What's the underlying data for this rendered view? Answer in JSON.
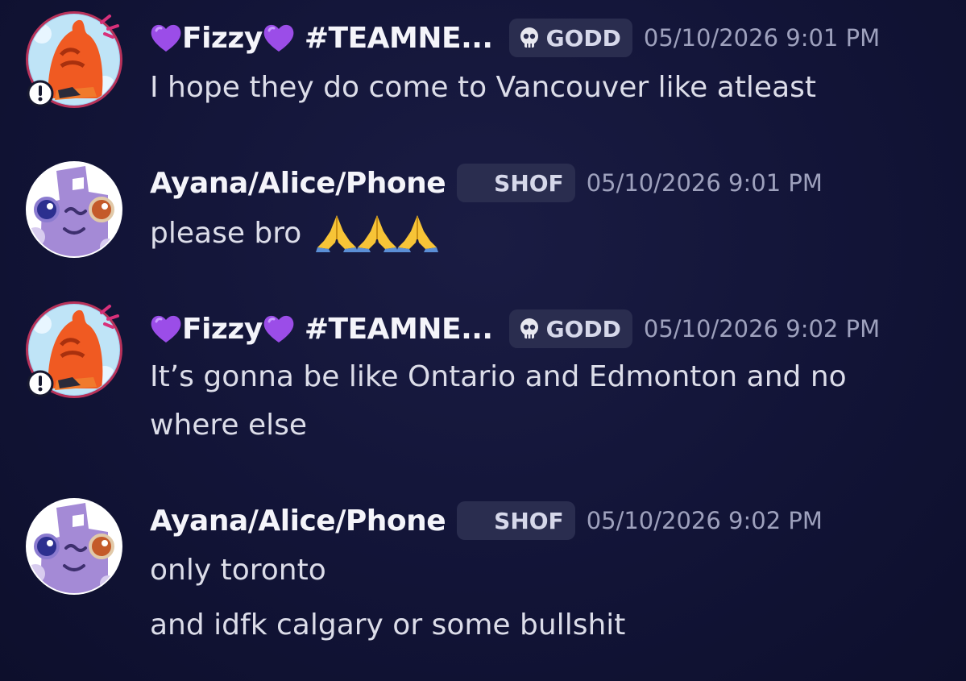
{
  "messages": [
    {
      "username": "Fizzy",
      "username_suffix": " #TEAMNE...",
      "tag": "GODD",
      "tag_icon": "skull-icon",
      "timestamp": "05/10/2026 9:01 PM",
      "lines": [
        "I hope they do come to Vancouver like atleast"
      ]
    },
    {
      "username": "Ayana/Alice/Phone",
      "tag": "SHOF",
      "tag_icon": "crescent-icon",
      "timestamp": "05/10/2026 9:01 PM",
      "lines": [
        "please bro"
      ],
      "emoji": [
        "folded-hands-emoji",
        "folded-hands-emoji",
        "folded-hands-emoji"
      ]
    },
    {
      "username": "Fizzy",
      "username_suffix": " #TEAMNE...",
      "tag": "GODD",
      "tag_icon": "skull-icon",
      "timestamp": "05/10/2026 9:02 PM",
      "lines": [
        "It’s gonna be like Ontario and Edmonton and no",
        "where else"
      ]
    },
    {
      "username": "Ayana/Alice/Phone",
      "tag": "SHOF",
      "tag_icon": "crescent-icon",
      "timestamp": "05/10/2026 9:02 PM",
      "lines": [
        "only toronto",
        "and idfk calgary or some bullshit"
      ]
    }
  ],
  "colors": {
    "background": "#121437",
    "username": "#f4f4fa",
    "message_text": "#dcdde9",
    "timestamp": "#9ea1bd",
    "tag_bg": "#2a2d4f",
    "heart": "#9b4de8",
    "crescent": "#f0b532"
  }
}
